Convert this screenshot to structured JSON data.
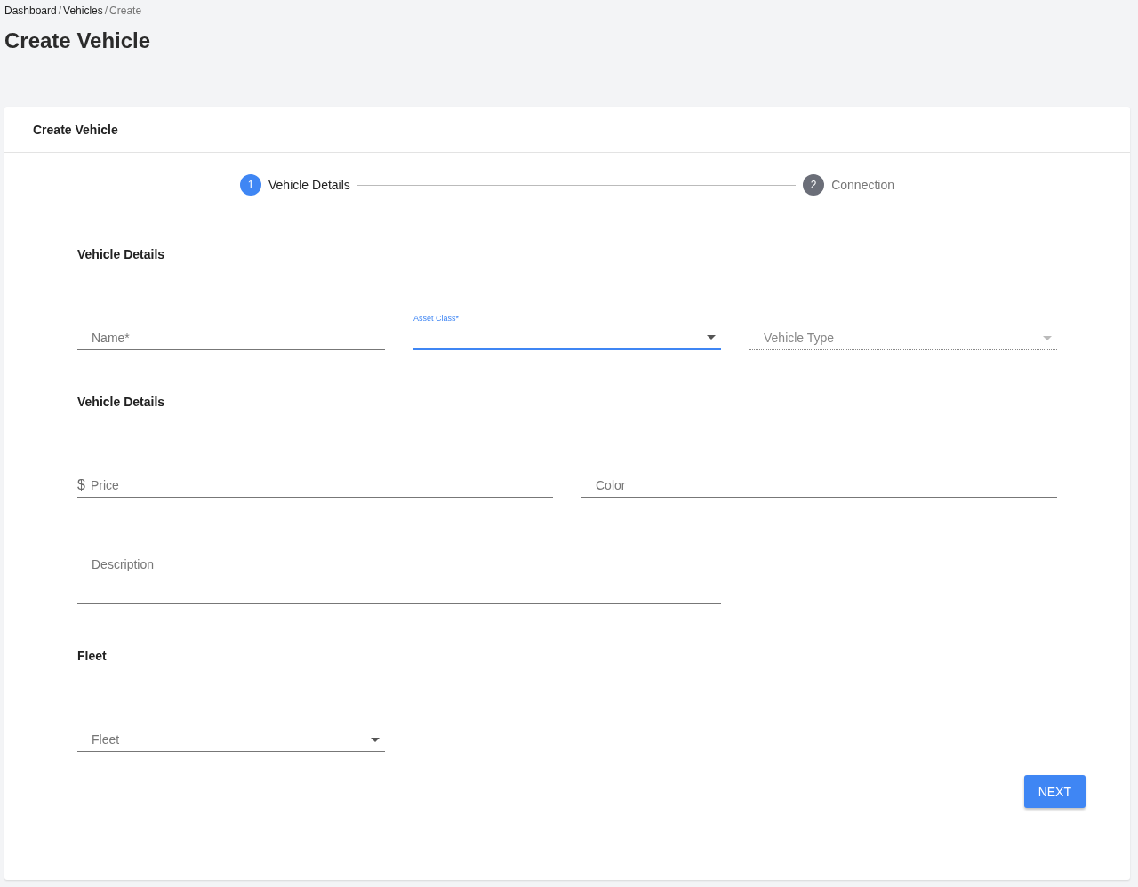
{
  "breadcrumb": [
    {
      "label": "Dashboard",
      "current": false
    },
    {
      "label": "Vehicles",
      "current": false
    },
    {
      "label": "Create",
      "current": true
    }
  ],
  "separator": "/",
  "page_title": "Create Vehicle",
  "card": {
    "title": "Create Vehicle"
  },
  "steps": [
    {
      "number": "1",
      "label": "Vehicle Details",
      "selected": true
    },
    {
      "number": "2",
      "label": "Connection",
      "selected": false
    }
  ],
  "sections": [
    {
      "title": "Vehicle Details",
      "rows": [
        [
          {
            "kind": "text",
            "placeholder": "Name*",
            "focused": false,
            "disabled": false
          },
          {
            "kind": "select",
            "label": "Asset Class*",
            "focused": true,
            "disabled": false
          },
          {
            "kind": "select",
            "placeholder": "Vehicle Type",
            "focused": false,
            "disabled": true
          }
        ]
      ]
    },
    {
      "title": "Vehicle Details",
      "rows": [
        [
          {
            "kind": "text",
            "prefix": "$",
            "placeholder": "Price",
            "focused": false,
            "disabled": false
          },
          {
            "kind": "text",
            "placeholder": "Color",
            "focused": false,
            "disabled": false
          }
        ],
        [
          {
            "kind": "multiline",
            "placeholder": "Description",
            "focused": false,
            "disabled": false
          }
        ]
      ]
    },
    {
      "title": "Fleet",
      "rows": [
        [
          {
            "kind": "select",
            "placeholder": "Fleet",
            "focused": false,
            "disabled": false
          }
        ]
      ]
    }
  ],
  "buttons": [
    {
      "label": "NEXT"
    }
  ]
}
